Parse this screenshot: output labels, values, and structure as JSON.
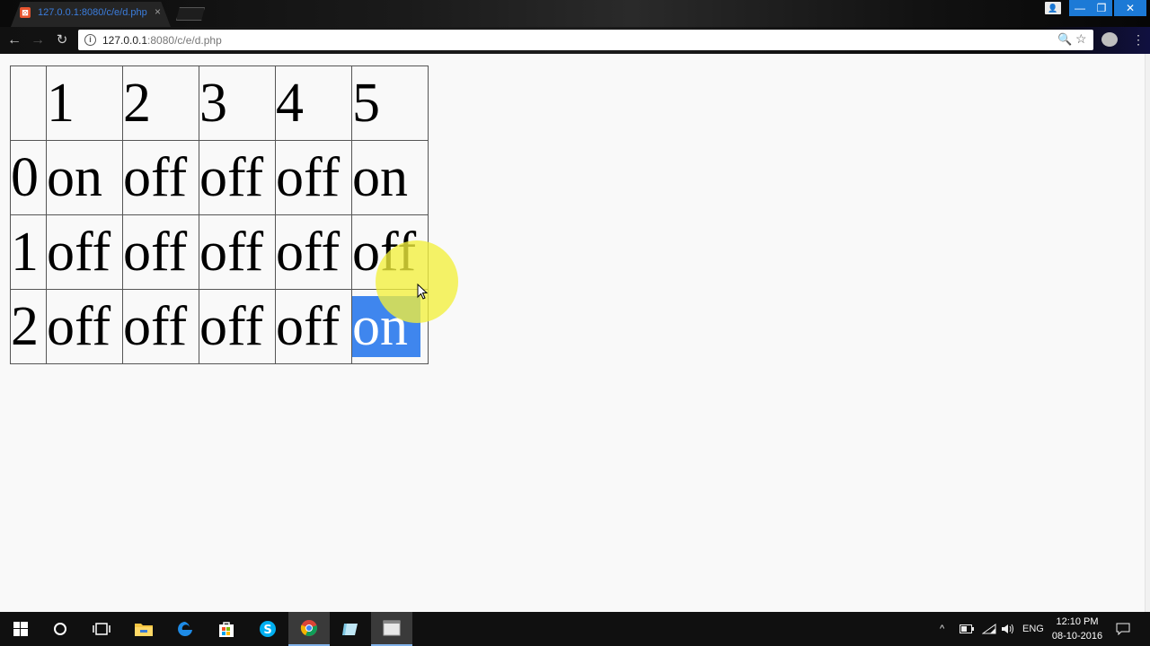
{
  "browser": {
    "tab_title": "127.0.0.1:8080/c/e/d.php",
    "tab_close": "×",
    "url_host": "127.0.0.1",
    "url_rest": ":8080/c/e/d.php"
  },
  "table": {
    "header": [
      "",
      "1",
      "2",
      "3",
      "4",
      "5"
    ],
    "rows": [
      {
        "label": "0",
        "cells": [
          "on",
          "off",
          "off",
          "off",
          "on"
        ]
      },
      {
        "label": "1",
        "cells": [
          "off",
          "off",
          "off",
          "off",
          "off"
        ]
      },
      {
        "label": "2",
        "cells": [
          "off",
          "off",
          "off",
          "off",
          "on"
        ]
      }
    ],
    "highlighted_cell": "on"
  },
  "taskbar": {
    "language": "ENG",
    "time": "12:10 PM",
    "date": "08-10-2016"
  },
  "colors": {
    "selection": "#3f86ee",
    "cursor_halo": "#f2f03c",
    "window_buttons": "#1c7ad6"
  },
  "icons": [
    "back-icon",
    "forward-icon",
    "reload-icon",
    "info-icon",
    "zoom-icon",
    "star-icon",
    "menu-icon",
    "start-icon",
    "cortana-icon",
    "task-view-icon",
    "file-explorer-icon",
    "edge-icon",
    "store-icon",
    "skype-icon",
    "chrome-icon",
    "notepad-icon",
    "window-icon",
    "notification-icon"
  ]
}
